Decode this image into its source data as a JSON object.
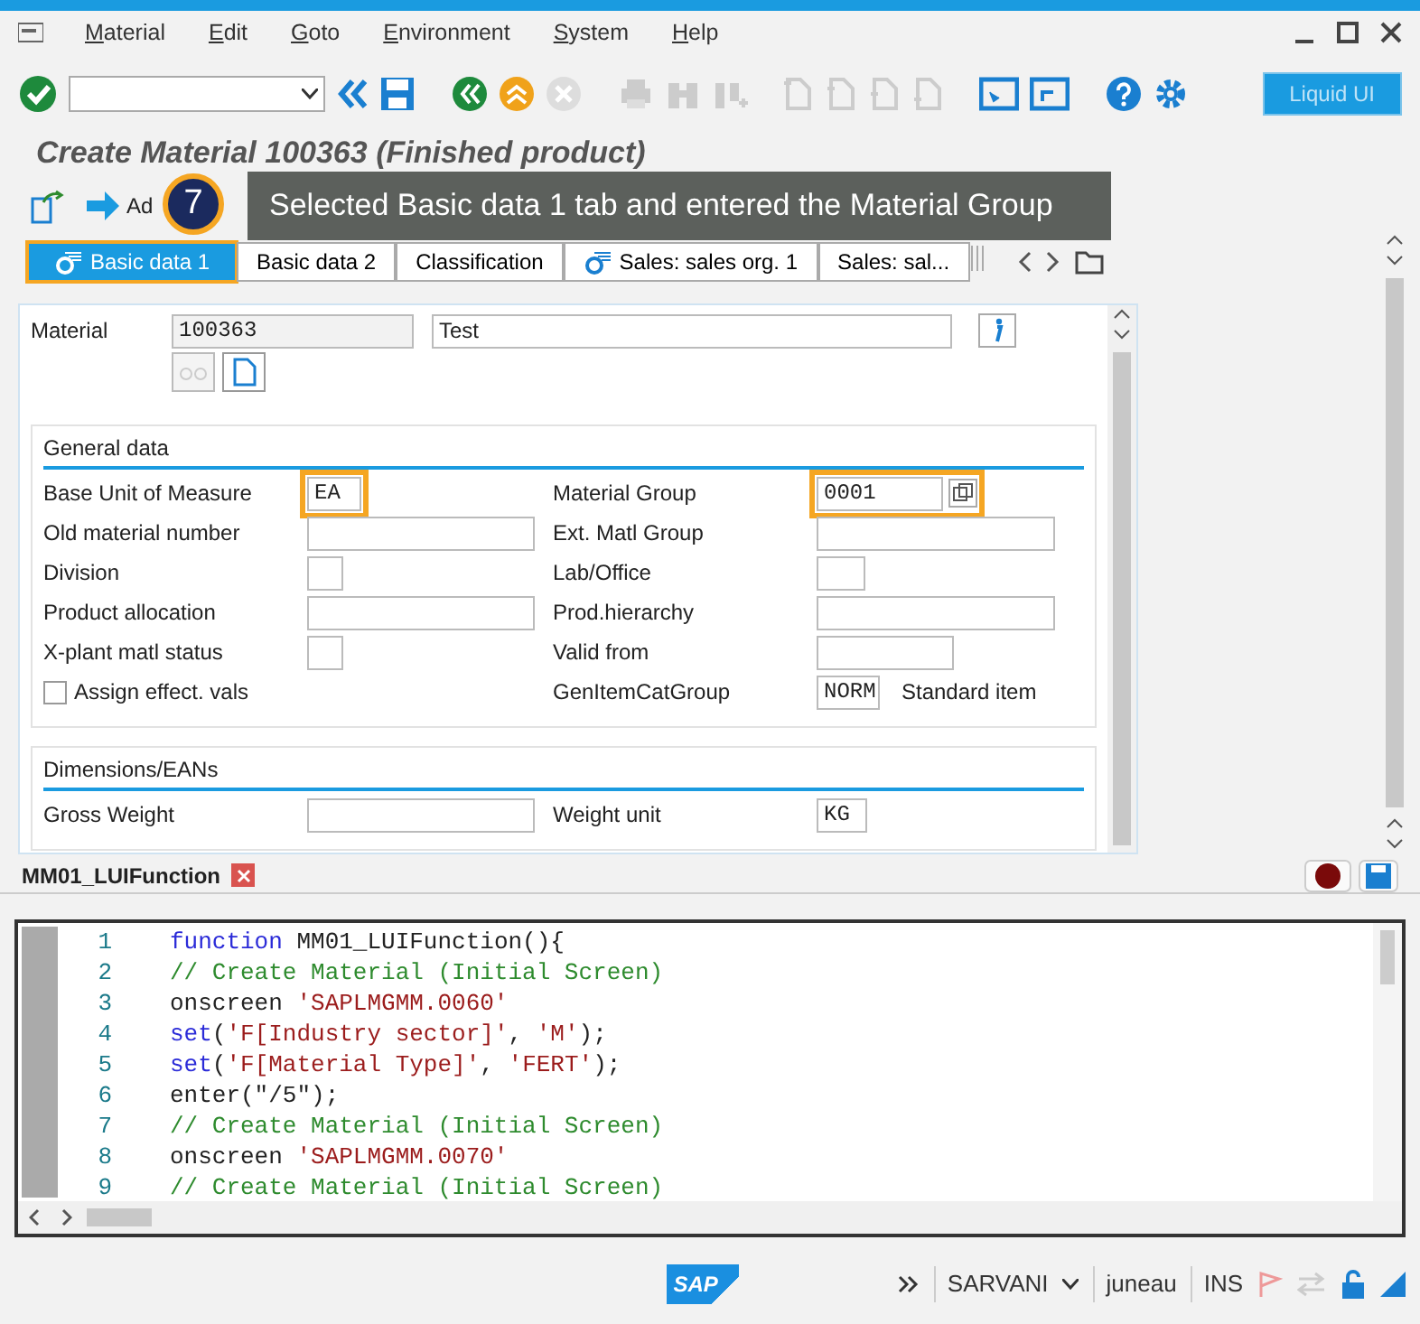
{
  "menu": [
    "Material",
    "Edit",
    "Goto",
    "Environment",
    "System",
    "Help"
  ],
  "toolbar": {
    "button": "Liquid UI"
  },
  "title": "Create Material 100363 (Finished product)",
  "app_toolbar": {
    "label": "Ad"
  },
  "callout": {
    "number": "7",
    "text": "Selected Basic data 1 tab and entered the Material Group"
  },
  "tabs": [
    {
      "label": "Basic data 1",
      "selected": true,
      "icon": true
    },
    {
      "label": "Basic data 2",
      "selected": false,
      "icon": false
    },
    {
      "label": "Classification",
      "selected": false,
      "icon": false
    },
    {
      "label": "Sales: sales org. 1",
      "selected": false,
      "icon": true
    },
    {
      "label": "Sales: sal...",
      "selected": false,
      "icon": false
    }
  ],
  "material": {
    "label": "Material",
    "number": "100363",
    "description": "Test"
  },
  "sections": [
    {
      "title": "General data",
      "rows": [
        {
          "left": {
            "kind": "field",
            "label": "Base Unit of Measure",
            "value": "EA",
            "highlighted": true
          },
          "right": {
            "kind": "field",
            "label": "Material Group",
            "value": "0001",
            "highlighted": true,
            "search_help": true
          }
        },
        {
          "left": {
            "kind": "field",
            "label": "Old material number",
            "highlighted": false
          },
          "right": {
            "kind": "field",
            "label": "Ext. Matl Group",
            "highlighted": false
          }
        },
        {
          "left": {
            "kind": "field",
            "label": "Division",
            "highlighted": false
          },
          "right": {
            "kind": "field",
            "label": "Lab/Office",
            "highlighted": false
          }
        },
        {
          "left": {
            "kind": "field",
            "label": "Product allocation",
            "highlighted": false
          },
          "right": {
            "kind": "field",
            "label": "Prod.hierarchy",
            "highlighted": false
          }
        },
        {
          "left": {
            "kind": "field",
            "label": "X-plant matl status",
            "highlighted": false
          },
          "right": {
            "kind": "field",
            "label": "Valid from",
            "highlighted": false
          }
        },
        {
          "left": {
            "kind": "checkbox",
            "label": "Assign effect. vals",
            "checked": false
          },
          "right": {
            "kind": "field",
            "label": "GenItemCatGroup",
            "value": "NORM",
            "highlighted": false,
            "note": "Standard item"
          }
        }
      ]
    },
    {
      "title": "Dimensions/EANs",
      "rows": [
        {
          "left": {
            "kind": "field",
            "label": "Gross Weight",
            "highlighted": false
          },
          "right": {
            "kind": "field",
            "label": "Weight unit",
            "value": "KG",
            "highlighted": false
          }
        }
      ]
    }
  ],
  "editor": {
    "tab": "MM01_LUIFunction",
    "lines": [
      {
        "number": "1",
        "tokens": [
          {
            "kind": "keyword",
            "text": "function"
          },
          {
            "kind": "plain",
            "text": " MM01_LUIFunction(){"
          }
        ]
      },
      {
        "number": "2",
        "tokens": [
          {
            "kind": "comment",
            "text": "// Create Material (Initial Screen)"
          }
        ]
      },
      {
        "number": "3",
        "tokens": [
          {
            "kind": "plain",
            "text": "onscreen "
          },
          {
            "kind": "string",
            "text": "'SAPLMGMM.0060'"
          }
        ]
      },
      {
        "number": "4",
        "tokens": [
          {
            "kind": "keyword",
            "text": "set"
          },
          {
            "kind": "plain",
            "text": "("
          },
          {
            "kind": "string",
            "text": "'F[Industry sector]'"
          },
          {
            "kind": "plain",
            "text": ", "
          },
          {
            "kind": "string",
            "text": "'M'"
          },
          {
            "kind": "plain",
            "text": ");"
          }
        ]
      },
      {
        "number": "5",
        "tokens": [
          {
            "kind": "keyword",
            "text": "set"
          },
          {
            "kind": "plain",
            "text": "("
          },
          {
            "kind": "string",
            "text": "'F[Material Type]'"
          },
          {
            "kind": "plain",
            "text": ", "
          },
          {
            "kind": "string",
            "text": "'FERT'"
          },
          {
            "kind": "plain",
            "text": ");"
          }
        ]
      },
      {
        "number": "6",
        "tokens": [
          {
            "kind": "plain",
            "text": "enter(\"/5\");"
          }
        ]
      },
      {
        "number": "7",
        "tokens": [
          {
            "kind": "comment",
            "text": "// Create Material (Initial Screen)"
          }
        ]
      },
      {
        "number": "8",
        "tokens": [
          {
            "kind": "plain",
            "text": "onscreen "
          },
          {
            "kind": "string",
            "text": "'SAPLMGMM.0070'"
          }
        ]
      },
      {
        "number": "9",
        "tokens": [
          {
            "kind": "comment",
            "text": "// Create Material (Initial Screen)"
          }
        ]
      }
    ]
  },
  "status_bar": {
    "logo": "SAP",
    "system": "SARVANI",
    "server": "juneau",
    "mode": "INS"
  }
}
